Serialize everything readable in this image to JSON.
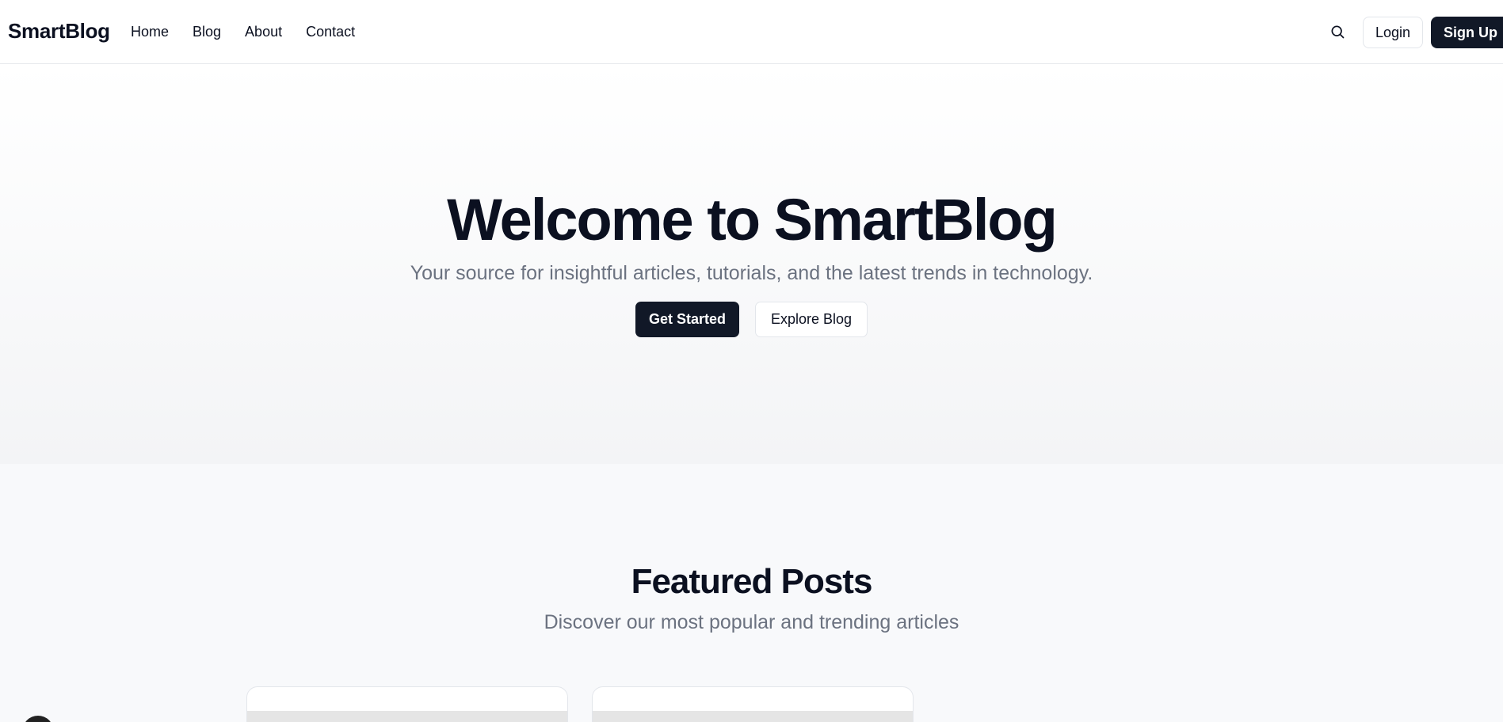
{
  "header": {
    "brand": "SmartBlog",
    "nav": [
      {
        "label": "Home"
      },
      {
        "label": "Blog"
      },
      {
        "label": "About"
      },
      {
        "label": "Contact"
      }
    ],
    "search_icon": "search-icon",
    "login_label": "Login",
    "signup_label": "Sign Up"
  },
  "hero": {
    "title": "Welcome to SmartBlog",
    "subtitle": "Your source for insightful articles, tutorials, and the latest trends in technology.",
    "primary_cta": "Get Started",
    "secondary_cta": "Explore Blog"
  },
  "featured": {
    "title": "Featured Posts",
    "subtitle": "Discover our most popular and trending articles"
  },
  "colors": {
    "brand_dark": "#111827",
    "muted_text": "#6b7280",
    "page_bg": "#f8f9fb"
  }
}
